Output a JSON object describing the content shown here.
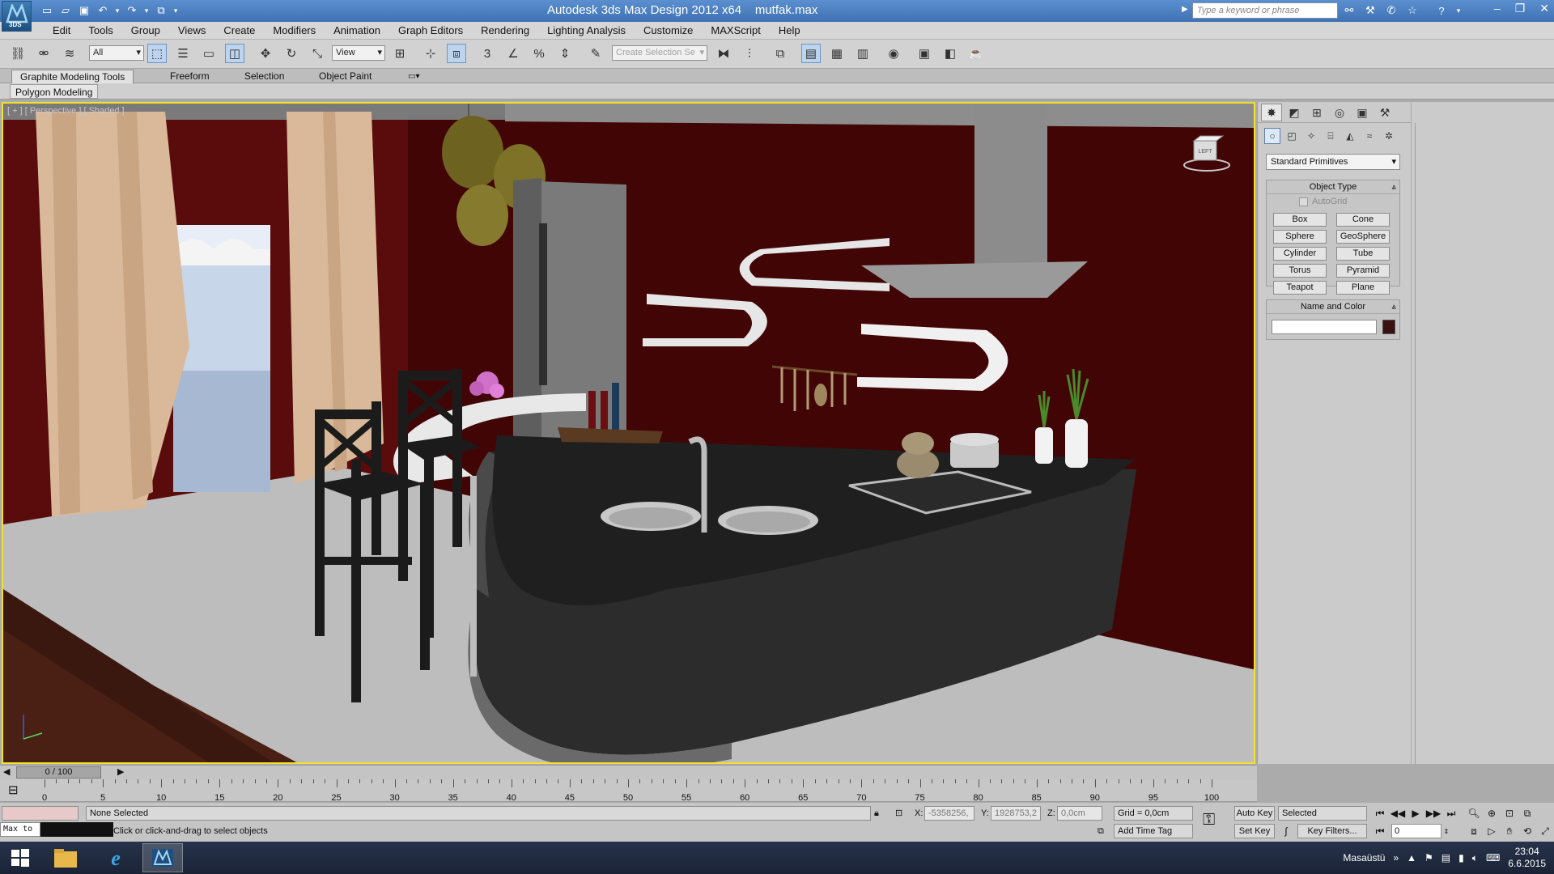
{
  "app": {
    "title": "Autodesk 3ds Max Design 2012 x64",
    "file": "mutfak.max",
    "logo_text": "3DS",
    "search_placeholder": "Type a keyword or phrase"
  },
  "menu": [
    "Edit",
    "Tools",
    "Group",
    "Views",
    "Create",
    "Modifiers",
    "Animation",
    "Graph Editors",
    "Rendering",
    "Lighting Analysis",
    "Customize",
    "MAXScript",
    "Help"
  ],
  "toolbar": {
    "filter": "All",
    "ref_coord": "View",
    "named_selection_placeholder": "Create Selection Se"
  },
  "ribbon": {
    "tabs": [
      "Graphite Modeling Tools",
      "Freeform",
      "Selection",
      "Object Paint"
    ],
    "panel": "Polygon Modeling"
  },
  "viewport": {
    "label": "[ + ] [ Perspective ] [ Shaded ]",
    "cube_label": "LEFT"
  },
  "command_panel": {
    "category": "Standard Primitives",
    "object_type_title": "Object Type",
    "autogrid_label": "AutoGrid",
    "primitives": [
      "Box",
      "Cone",
      "Sphere",
      "GeoSphere",
      "Cylinder",
      "Tube",
      "Torus",
      "Pyramid",
      "Teapot",
      "Plane"
    ],
    "name_color_title": "Name and Color",
    "object_color": "#3a1010"
  },
  "timeline": {
    "slider_label": "0 / 100",
    "ticks": [
      0,
      5,
      10,
      15,
      20,
      25,
      30,
      35,
      40,
      45,
      50,
      55,
      60,
      65,
      70,
      75,
      80,
      85,
      90,
      95,
      100
    ]
  },
  "status": {
    "selection": "None Selected",
    "prompt": "Click or click-and-drag to select objects",
    "maxscript": "Max to",
    "x_label": "X:",
    "x_value": "-5358256,",
    "y_label": "Y:",
    "y_value": "1928753,2",
    "z_label": "Z:",
    "z_value": "0,0cm",
    "grid": "Grid = 0,0cm",
    "add_time_tag": "Add Time Tag"
  },
  "anim": {
    "auto_key": "Auto Key",
    "set_key": "Set Key",
    "key_mode": "Selected",
    "key_filters": "Key Filters...",
    "frame": "0"
  },
  "taskbar": {
    "desktop_label": "Masaüstü",
    "time": "23:04",
    "date": "6.6.2015"
  }
}
